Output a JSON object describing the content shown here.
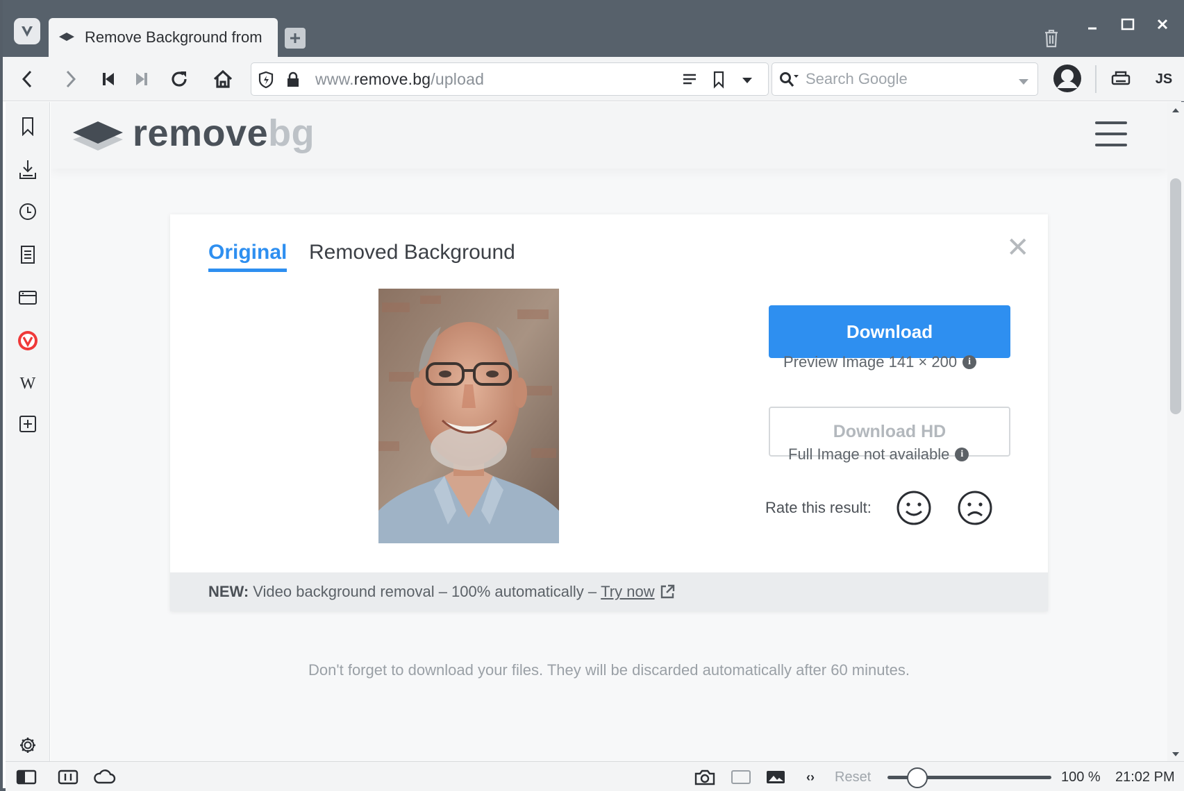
{
  "tab": {
    "title": "Remove Background from"
  },
  "address": {
    "url_prefix": "www.",
    "url_domain": "remove.bg",
    "url_path": "/upload"
  },
  "search": {
    "placeholder": "Search Google"
  },
  "toolbar": {
    "js_label": "JS"
  },
  "site": {
    "brand_main": "remove",
    "brand_suffix": "bg"
  },
  "card": {
    "tab_original": "Original",
    "tab_removed": "Removed Background",
    "close_symbol": "✕",
    "download_label": "Download",
    "preview_caption": "Preview Image 141 × 200",
    "download_hd_label": "Download HD",
    "hd_caption": "Full Image not available",
    "rate_label": "Rate this result:"
  },
  "banner": {
    "new_label": "NEW:",
    "text": "Video background removal – 100% automatically –",
    "link": "Try now"
  },
  "note": "Don't forget to download your files. They will be discarded automatically after 60 minutes.",
  "statusbar": {
    "reset_label": "Reset",
    "zoom": "100 %",
    "clock": "21:02 PM"
  },
  "colors": {
    "accent": "#2e8ff0",
    "chrome": "#57616b",
    "vivaldi_red": "#ef3939"
  },
  "icons": [
    "vivaldi-logo-icon",
    "back-icon",
    "forward-icon",
    "rewind-icon",
    "fast-forward-icon",
    "reload-icon",
    "home-icon",
    "shield-icon",
    "lock-icon",
    "reader-icon",
    "bookmark-icon",
    "dropdown-icon",
    "search-icon",
    "profile-icon",
    "print-icon",
    "trash-icon",
    "minimize-icon",
    "maximize-icon",
    "close-icon",
    "bookmarks-panel-icon",
    "downloads-icon",
    "history-icon",
    "notes-icon",
    "window-icon",
    "vivaldi-panel-icon",
    "wikipedia-icon",
    "add-panel-icon",
    "settings-icon",
    "menu-icon",
    "smile-icon",
    "frown-icon",
    "external-link-icon",
    "panel-toggle-icon",
    "tiling-icon",
    "sync-icon",
    "capture-icon",
    "page-actions-icon",
    "images-icon",
    "code-icon"
  ]
}
